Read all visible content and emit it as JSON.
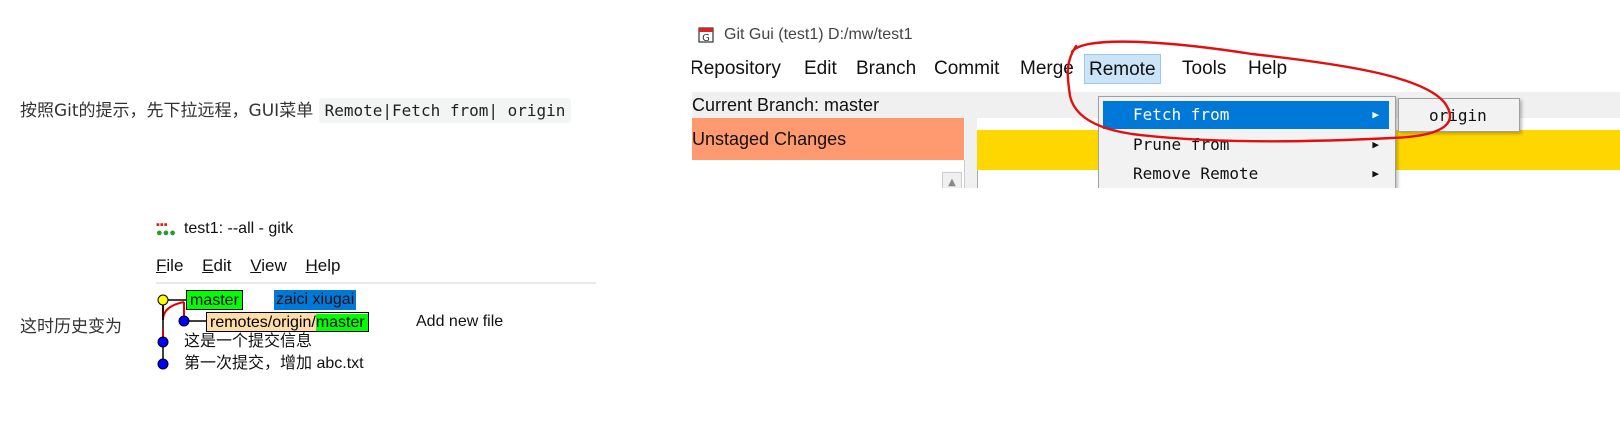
{
  "paragraph1": {
    "text": "按照Git的提示，先下拉远程，GUI菜单",
    "code": "Remote|Fetch from| origin"
  },
  "gitgui": {
    "title": "Git Gui (test1) D:/mw/test1",
    "menus": [
      "Repository",
      "Edit",
      "Branch",
      "Commit",
      "Merge",
      "Remote",
      "Tools",
      "Help"
    ],
    "current_branch": "Current Branch: master",
    "unstaged_label": "Unstaged Changes",
    "remote_menu_items": [
      {
        "label": "Fetch from"
      },
      {
        "label": "Prune from"
      },
      {
        "label": "Remove Remote"
      }
    ],
    "submenu_item": "origin",
    "colors": {
      "highlight": "#0078d7",
      "unstaged": "#ff9a70",
      "staged_header": "#ffd700",
      "annotation": "#e01010"
    }
  },
  "paragraph2": {
    "text": "这时历史变为"
  },
  "gitk": {
    "title": "test1: --all - gitk",
    "menus": [
      {
        "key": "F",
        "rest": "ile"
      },
      {
        "key": "E",
        "rest": "dit"
      },
      {
        "key": "V",
        "rest": "iew"
      },
      {
        "key": "H",
        "rest": "elp"
      }
    ],
    "commits": [
      {
        "refs": [
          "master"
        ],
        "message": "zaici xiugai",
        "selected": true
      },
      {
        "refs_remote_prefix": "remotes/origin/",
        "refs_remote_branch": "master",
        "message": "Add new file"
      },
      {
        "message": "这是一个提交信息"
      },
      {
        "message": "第一次提交，增加 abc.txt"
      }
    ],
    "colors": {
      "head_node": "#ffff00",
      "node": "#0000ff",
      "branch_line": "#e00000",
      "local_branch": "#00ff00",
      "remote_branch": "#ffddaa",
      "selection": "#0078d7"
    }
  }
}
